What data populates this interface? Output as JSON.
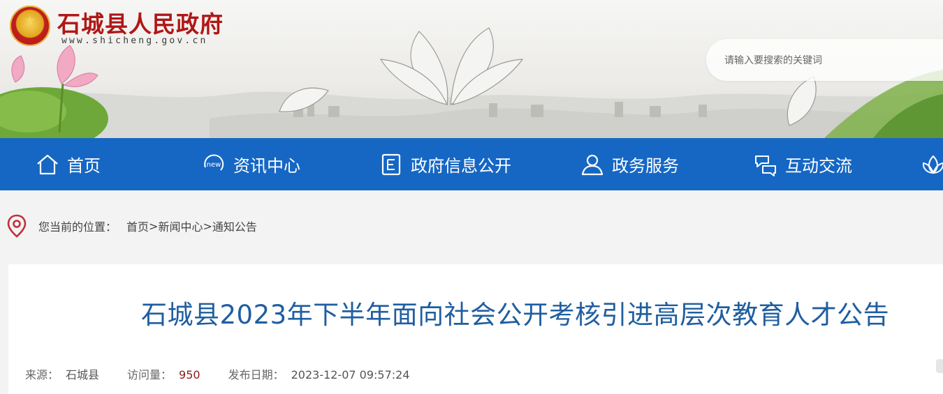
{
  "header": {
    "site_title": "石城县人民政府",
    "site_url": "www.shicheng.gov.cn",
    "search_placeholder": "请输入要搜索的关键词"
  },
  "nav": {
    "items": [
      {
        "label": "首页",
        "icon": "home-icon"
      },
      {
        "label": "资讯中心",
        "icon": "news-icon"
      },
      {
        "label": "政府信息公开",
        "icon": "document-icon"
      },
      {
        "label": "政务服务",
        "icon": "user-icon"
      },
      {
        "label": "互动交流",
        "icon": "exchange-icon"
      }
    ],
    "partial_icon": "lotus-icon"
  },
  "breadcrumb": {
    "label": "您当前的位置：",
    "items": [
      "首页",
      "新闻中心",
      "通知公告"
    ],
    "separator": ">"
  },
  "article": {
    "title": "石城县2023年下半年面向社会公开考核引进高层次教育人才公告",
    "source_label": "来源：",
    "source_value": "石城县",
    "views_label": "访问量：",
    "views_value": "950",
    "date_label": "发布日期：",
    "date_value": "2023-12-07 09:57:24"
  },
  "colors": {
    "nav_blue": "#1667c4",
    "title_red": "#b01716",
    "article_title_blue": "#1f5ea0",
    "views_red": "#8b1c1c"
  }
}
